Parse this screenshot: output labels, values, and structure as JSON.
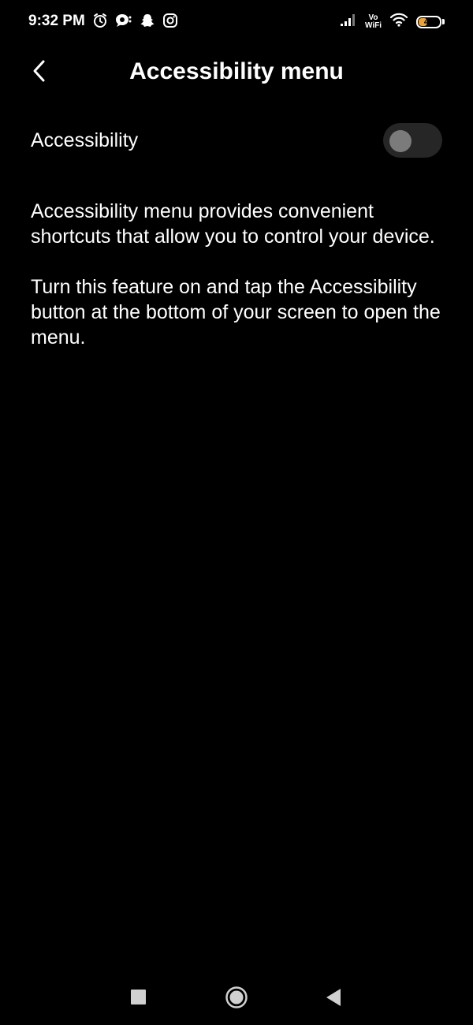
{
  "status_bar": {
    "time": "9:32 PM",
    "left_icons": [
      "alarm-icon",
      "chat-bubble-icon",
      "snapchat-icon",
      "instagram-icon"
    ],
    "vowifi_top": "Vo",
    "vowifi_bottom": "WiFi",
    "battery_level": "44",
    "battery_fill_color": "#e9a33d"
  },
  "header": {
    "title": "Accessibility menu"
  },
  "setting": {
    "label": "Accessibility",
    "enabled": false
  },
  "description": {
    "paragraph_1": "Accessibility menu provides convenient shortcuts that allow you to control your device.",
    "paragraph_2": "Turn this feature on and tap the Accessibility button at the bottom of your screen to open the menu."
  },
  "nav_bar": {
    "buttons": [
      "recents-button",
      "home-button",
      "back-button"
    ]
  }
}
